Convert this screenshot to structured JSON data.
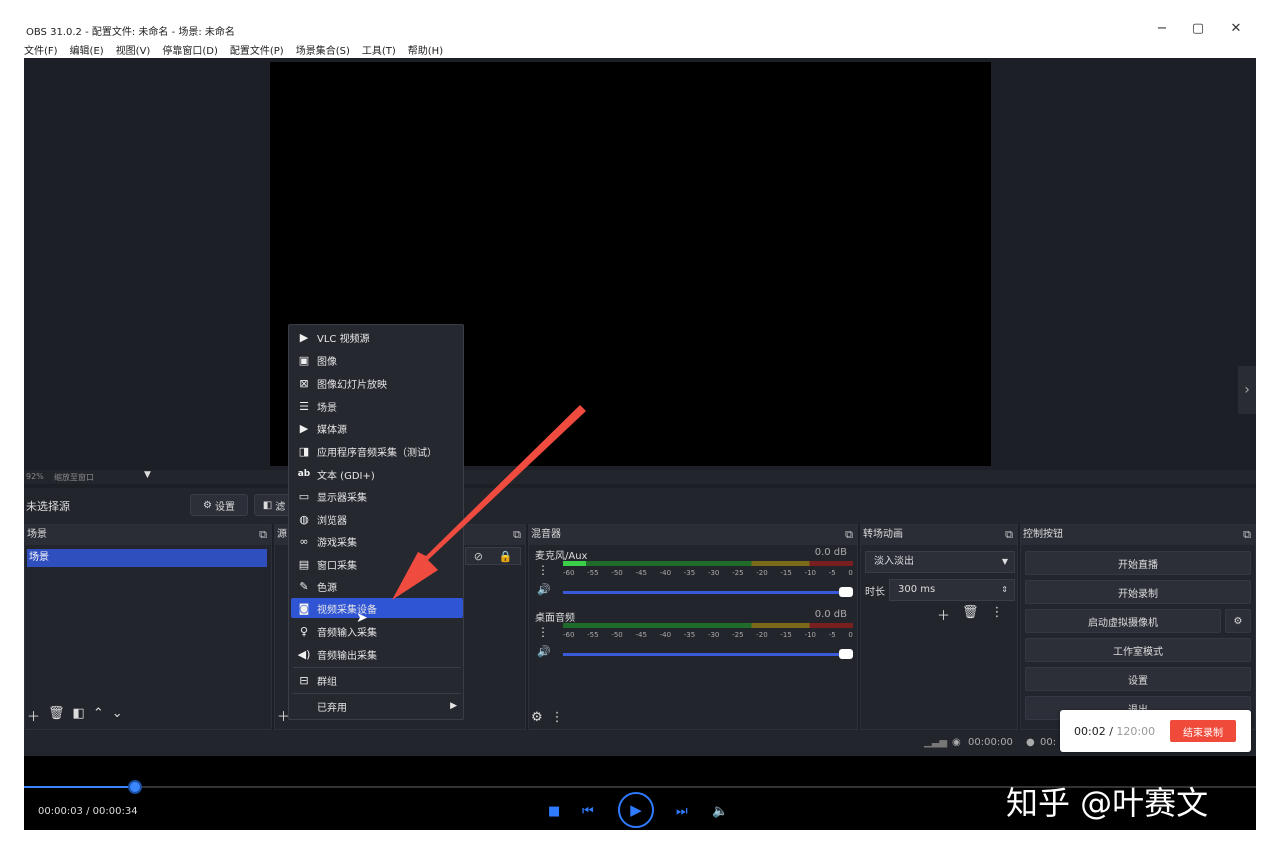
{
  "window": {
    "title": "OBS 31.0.2 - 配置文件: 未命名 - 场景: 未命名",
    "controls": [
      "−",
      "▢",
      "✕"
    ]
  },
  "menu": [
    "文件(F)",
    "编辑(E)",
    "视图(V)",
    "停靠窗口(D)",
    "配置文件(P)",
    "场景集合(S)",
    "工具(T)",
    "帮助(H)"
  ],
  "zoom": {
    "percent": "92%",
    "label": "缩放至窗口"
  },
  "source_bar": {
    "label": "未选择源",
    "settings": "设置",
    "filters": "滤"
  },
  "docks": {
    "scenes": {
      "title": "场景",
      "items": [
        "场景"
      ]
    },
    "sources": {
      "title": "源"
    },
    "mixer": {
      "title": "混音器",
      "channels": [
        {
          "name": "麦克风/Aux",
          "db": "0.0 dB",
          "level": 0.08
        },
        {
          "name": "桌面音频",
          "db": "0.0 dB",
          "level": 0.0
        }
      ],
      "scale": [
        "-60",
        "-55",
        "-50",
        "-45",
        "-40",
        "-35",
        "-30",
        "-25",
        "-20",
        "-15",
        "-10",
        "-5",
        "0"
      ]
    },
    "transitions": {
      "title": "转场动画",
      "selected": "淡入淡出",
      "duration_label": "时长",
      "duration_value": "300 ms"
    },
    "controls": {
      "title": "控制按钮",
      "buttons": [
        "开始直播",
        "开始录制",
        "启动虚拟摄像机",
        "工作室模式",
        "设置",
        "退出"
      ]
    }
  },
  "context_menu": {
    "items": [
      "VLC 视频源",
      "图像",
      "图像幻灯片放映",
      "场景",
      "媒体源",
      "应用程序音频采集（测试）",
      "文本 (GDI+)",
      "显示器采集",
      "浏览器",
      "游戏采集",
      "窗口采集",
      "色源",
      "视频采集设备",
      "音频输入采集",
      "音频输出采集"
    ],
    "selected_index": 12,
    "group": "群组",
    "deprecated": "已弃用"
  },
  "status": {
    "rec_time": "00:00:00",
    "stream_time": "00:"
  },
  "rec_popup": {
    "elapsed": "00:02",
    "total": "120:00",
    "stop": "结束录制"
  },
  "player": {
    "time": "00:00:03 / 00:00:34",
    "progress": 0.09
  },
  "watermark": "知乎 @叶赛文"
}
